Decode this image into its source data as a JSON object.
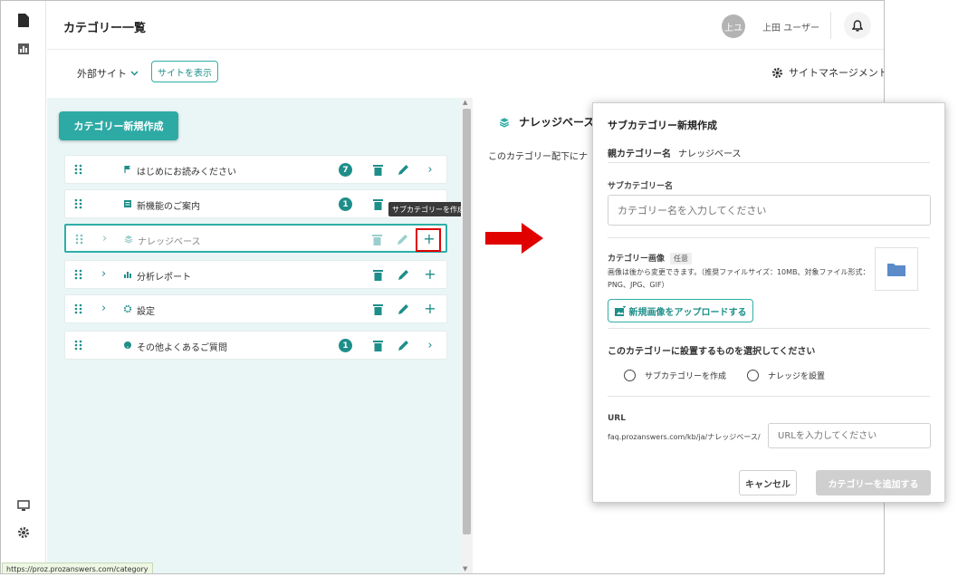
{
  "header": {
    "title": "カテゴリー一覧",
    "avatar_initials": "上ユ",
    "user_name": "上田 ユーザー"
  },
  "toolbar": {
    "site_select": "外部サイト",
    "view_site": "サイトを表示",
    "site_management": "サイトマネージメント"
  },
  "panel": {
    "new_category": "カテゴリー新規作成",
    "rows": [
      {
        "label": "はじめにお読みください",
        "badge": "7",
        "end": "chevron"
      },
      {
        "label": "新機能のご案内",
        "badge": "1",
        "end": "chevron"
      },
      {
        "label": "ナレッジベース",
        "badge": "",
        "end": "plus"
      },
      {
        "label": "分析レポート",
        "badge": "",
        "end": "plus"
      },
      {
        "label": "設定",
        "badge": "",
        "end": "plus"
      },
      {
        "label": "その他よくあるご質問",
        "badge": "1",
        "end": "chevron"
      }
    ],
    "tooltip": "サブカテゴリーを作成"
  },
  "detail": {
    "title": "ナレッジベース",
    "description": "このカテゴリー配下にナ"
  },
  "status_url": "https://proz.prozanswers.com/category",
  "modal": {
    "title": "サブカテゴリー新規作成",
    "parent_label": "親カテゴリー名",
    "parent_value": "ナレッジベース",
    "sub_name_label": "サブカテゴリー名",
    "sub_name_placeholder": "カテゴリー名を入力してください",
    "image_label": "カテゴリー画像",
    "optional": "任意",
    "image_hint": "画像は後から変更できます。（推奨ファイルサイズ：10MB、対象ファイル形式：PNG、JPG、GIF）",
    "upload_button": "新規画像をアップロードする",
    "radio_question": "このカテゴリーに設置するものを選択してください",
    "radio_options": [
      "サブカテゴリーを作成",
      "ナレッジを設置"
    ],
    "url_label": "URL",
    "url_prefix": "faq.prozanswers.com/kb/ja/ナレッジベース/",
    "url_placeholder": "URLを入力してください",
    "cancel": "キャンセル",
    "add": "カテゴリーを追加する"
  },
  "colors": {
    "accent": "#2eaaa5",
    "panel_bg": "#eaf6f5",
    "highlight": "#e00000"
  }
}
